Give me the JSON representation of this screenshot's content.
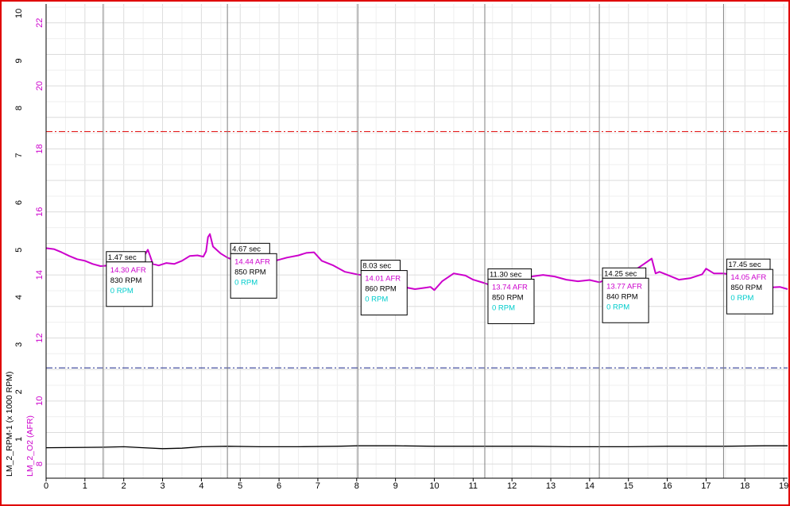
{
  "chart_data": {
    "type": "line",
    "xlim": [
      0,
      19.1
    ],
    "x_ticks": [
      "0",
      "1",
      "2",
      "3",
      "4",
      "5",
      "6",
      "7",
      "8",
      "9",
      "10",
      "11",
      "12",
      "13",
      "14",
      "15",
      "16",
      "17",
      "18",
      "19"
    ],
    "y_afr": {
      "label": "LM_2_O2 (AFR)",
      "ylim": [
        7.55,
        22.6
      ],
      "ticks": [
        "8",
        "10",
        "12",
        "14",
        "16",
        "18",
        "20",
        "22"
      ],
      "color": "#cc00cc"
    },
    "y_rpm": {
      "label": "LM_2_RPM-1 (x 1000 RPM)",
      "ylim": [
        0.175,
        10.2
      ],
      "ticks": [
        "1",
        "2",
        "3",
        "4",
        "5",
        "6",
        "7",
        "8",
        "9",
        "10"
      ],
      "color": "#000000"
    },
    "grid": true,
    "series": [
      {
        "name": "LM_2_O2 (AFR)",
        "axis": "afr",
        "color": "#cc00cc",
        "x": [
          0,
          0.2,
          0.4,
          0.6,
          0.8,
          1.0,
          1.2,
          1.4,
          1.6,
          1.9,
          2.2,
          2.45,
          2.55,
          2.62,
          2.68,
          2.75,
          2.9,
          3.1,
          3.3,
          3.5,
          3.7,
          3.9,
          4.05,
          4.12,
          4.17,
          4.22,
          4.3,
          4.5,
          4.67,
          4.9,
          5.1,
          5.3,
          5.6,
          5.9,
          6.2,
          6.5,
          6.7,
          6.9,
          7.1,
          7.4,
          7.7,
          8.0,
          8.3,
          8.6,
          8.9,
          9.2,
          9.5,
          9.8,
          9.9,
          10.0,
          10.2,
          10.5,
          10.8,
          11.0,
          11.3,
          11.6,
          11.9,
          12.2,
          12.5,
          12.8,
          13.1,
          13.4,
          13.7,
          14.0,
          14.25,
          14.5,
          14.8,
          15.1,
          15.4,
          15.6,
          15.7,
          15.8,
          16.0,
          16.3,
          16.6,
          16.9,
          17.0,
          17.2,
          17.45,
          17.7,
          18.0,
          18.3,
          18.6,
          18.9,
          19.1
        ],
        "y": [
          14.85,
          14.82,
          14.72,
          14.6,
          14.5,
          14.45,
          14.35,
          14.28,
          14.3,
          14.3,
          14.32,
          14.4,
          14.65,
          14.8,
          14.6,
          14.35,
          14.3,
          14.38,
          14.35,
          14.45,
          14.6,
          14.62,
          14.58,
          14.75,
          15.2,
          15.3,
          14.9,
          14.68,
          14.55,
          14.44,
          14.3,
          14.2,
          14.35,
          14.45,
          14.55,
          14.62,
          14.7,
          14.72,
          14.45,
          14.3,
          14.1,
          14.02,
          13.96,
          13.9,
          13.75,
          13.62,
          13.55,
          13.6,
          13.62,
          13.52,
          13.8,
          14.05,
          13.98,
          13.85,
          13.74,
          13.6,
          13.7,
          13.8,
          13.95,
          14.0,
          13.95,
          13.85,
          13.8,
          13.84,
          13.77,
          13.88,
          14.05,
          14.1,
          14.35,
          14.52,
          14.05,
          14.1,
          14.0,
          13.85,
          13.9,
          14.02,
          14.2,
          14.05,
          14.05,
          14.0,
          13.9,
          13.7,
          13.6,
          13.62,
          13.55
        ]
      },
      {
        "name": "LM_2_RPM-1 (x 1000 RPM)",
        "axis": "rpm",
        "color": "#000000",
        "x": [
          0,
          1.47,
          2.0,
          2.5,
          3.0,
          3.5,
          4.0,
          4.67,
          5.5,
          6.5,
          7.5,
          8.03,
          9.0,
          10.0,
          11.3,
          12.5,
          13.5,
          14.25,
          15.0,
          16.0,
          17.45,
          18.5,
          19.1
        ],
        "y": [
          0.82,
          0.83,
          0.84,
          0.82,
          0.8,
          0.81,
          0.84,
          0.85,
          0.84,
          0.84,
          0.85,
          0.86,
          0.86,
          0.85,
          0.85,
          0.85,
          0.84,
          0.84,
          0.84,
          0.85,
          0.85,
          0.86,
          0.86
        ]
      }
    ],
    "reference_lines": [
      {
        "axis": "afr",
        "value": 18.55,
        "color": "#e00000",
        "style": "dash-dot"
      },
      {
        "axis": "afr",
        "value": 11.05,
        "color": "#1c2a8c",
        "style": "dash-dot"
      }
    ],
    "cursors": [
      {
        "x": 1.47,
        "label": "1.47 sec",
        "afr": "14.30 AFR",
        "rpm1": "830 RPM",
        "rpm2": "0 RPM"
      },
      {
        "x": 4.67,
        "label": "4.67 sec",
        "afr": "14.44 AFR",
        "rpm1": "850 RPM",
        "rpm2": "0 RPM"
      },
      {
        "x": 8.03,
        "label": "8.03 sec",
        "afr": "14.01 AFR",
        "rpm1": "860 RPM",
        "rpm2": "0 RPM"
      },
      {
        "x": 11.3,
        "label": "11.30 sec",
        "afr": "13.74 AFR",
        "rpm1": "850 RPM",
        "rpm2": "0 RPM"
      },
      {
        "x": 14.25,
        "label": "14.25 sec",
        "afr": "13.77 AFR",
        "rpm1": "840 RPM",
        "rpm2": "0 RPM"
      },
      {
        "x": 17.45,
        "label": "17.45 sec",
        "afr": "14.05 AFR",
        "rpm1": "850 RPM",
        "rpm2": "0 RPM"
      }
    ]
  }
}
